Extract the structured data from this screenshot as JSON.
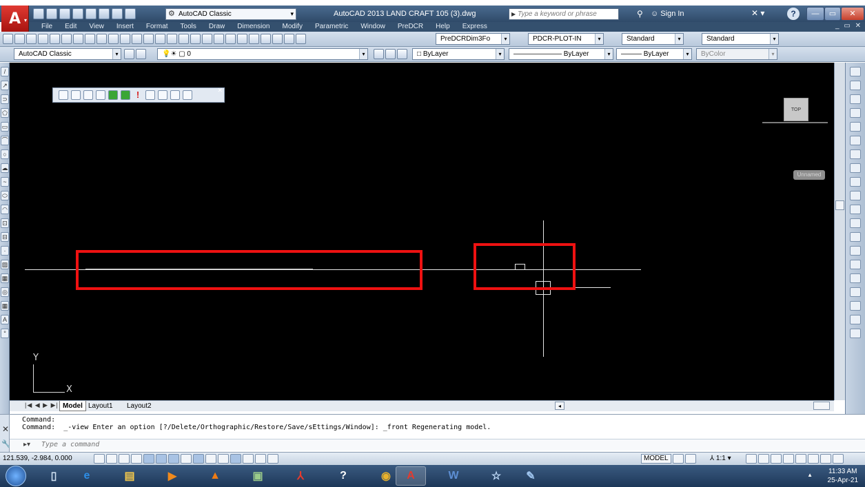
{
  "title_bar": {
    "workspace": "AutoCAD Classic",
    "window_title": "AutoCAD 2013   LAND CRAFT 105 (3).dwg",
    "search_placeholder": "Type a keyword or phrase",
    "signin": "Sign In"
  },
  "menu": [
    "File",
    "Edit",
    "View",
    "Insert",
    "Format",
    "Tools",
    "Draw",
    "Dimension",
    "Modify",
    "Parametric",
    "Window",
    "PreDCR",
    "Help",
    "Express"
  ],
  "toolbar1": {
    "dimstyle": "PreDCRDim3Fo",
    "plotstyle": "PDCR-PLOT-IN",
    "textstyle": "Standard",
    "tablestyle": "Standard"
  },
  "toolbar2": {
    "workspace": "AutoCAD Classic",
    "layer": "0",
    "color": "ByLayer",
    "linetype": "ByLayer",
    "lineweight": "ByLayer",
    "plotstyle": "ByColor"
  },
  "viewcube": {
    "face": "TOP",
    "ucs": "Unnamed"
  },
  "ucs_icon": {
    "x": "X",
    "y": "Y"
  },
  "tabs": {
    "model": "Model",
    "layout1": "Layout1",
    "layout2": "Layout2"
  },
  "command": {
    "line1": "Command:",
    "line2": "Command:  _-view Enter an option [?/Delete/Orthographic/Restore/Save/sEttings/Window]: _front Regenerating model.",
    "placeholder": "Type a command"
  },
  "status": {
    "coords": "121.539, -2.984, 0.000",
    "space": "MODEL",
    "annotation_scale": "1:1"
  },
  "taskbar": {
    "time": "11:33 AM",
    "date": "25-Apr-21"
  },
  "colors": {
    "highlight": "#ee1111",
    "canvas": "#000000"
  }
}
